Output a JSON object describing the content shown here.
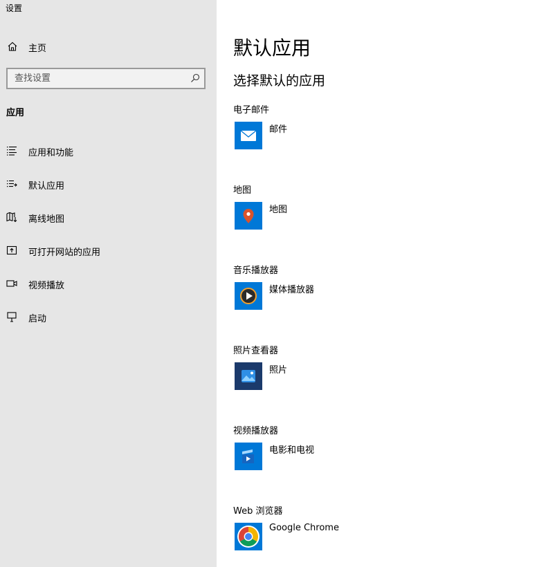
{
  "window": {
    "title": "设置"
  },
  "sidebar": {
    "home_label": "主页",
    "search_placeholder": "查找设置",
    "section_title": "应用",
    "items": [
      {
        "label": "应用和功能",
        "icon": "list-icon"
      },
      {
        "label": "默认应用",
        "icon": "default-apps-icon"
      },
      {
        "label": "离线地图",
        "icon": "offline-map-icon"
      },
      {
        "label": "可打开网站的应用",
        "icon": "open-website-icon"
      },
      {
        "label": "视频播放",
        "icon": "video-icon"
      },
      {
        "label": "启动",
        "icon": "startup-icon"
      }
    ]
  },
  "main": {
    "title": "默认应用",
    "subtitle": "选择默认的应用",
    "categories": [
      {
        "label": "电子邮件",
        "app": "邮件",
        "icon": "mail-icon",
        "tile_color": "#0078d7"
      },
      {
        "label": "地图",
        "app": "地图",
        "icon": "maps-pin-icon",
        "tile_color": "#0078d7"
      },
      {
        "label": "音乐播放器",
        "app": "媒体播放器",
        "icon": "media-player-icon",
        "tile_color": "#0078d7"
      },
      {
        "label": "照片查看器",
        "app": "照片",
        "icon": "photos-icon",
        "tile_color": "#1b3a6b"
      },
      {
        "label": "视频播放器",
        "app": "电影和电视",
        "icon": "movies-tv-icon",
        "tile_color": "#0078d7"
      },
      {
        "label": "Web 浏览器",
        "app": "Google Chrome",
        "icon": "chrome-icon",
        "tile_color": "#0078d7"
      }
    ]
  }
}
